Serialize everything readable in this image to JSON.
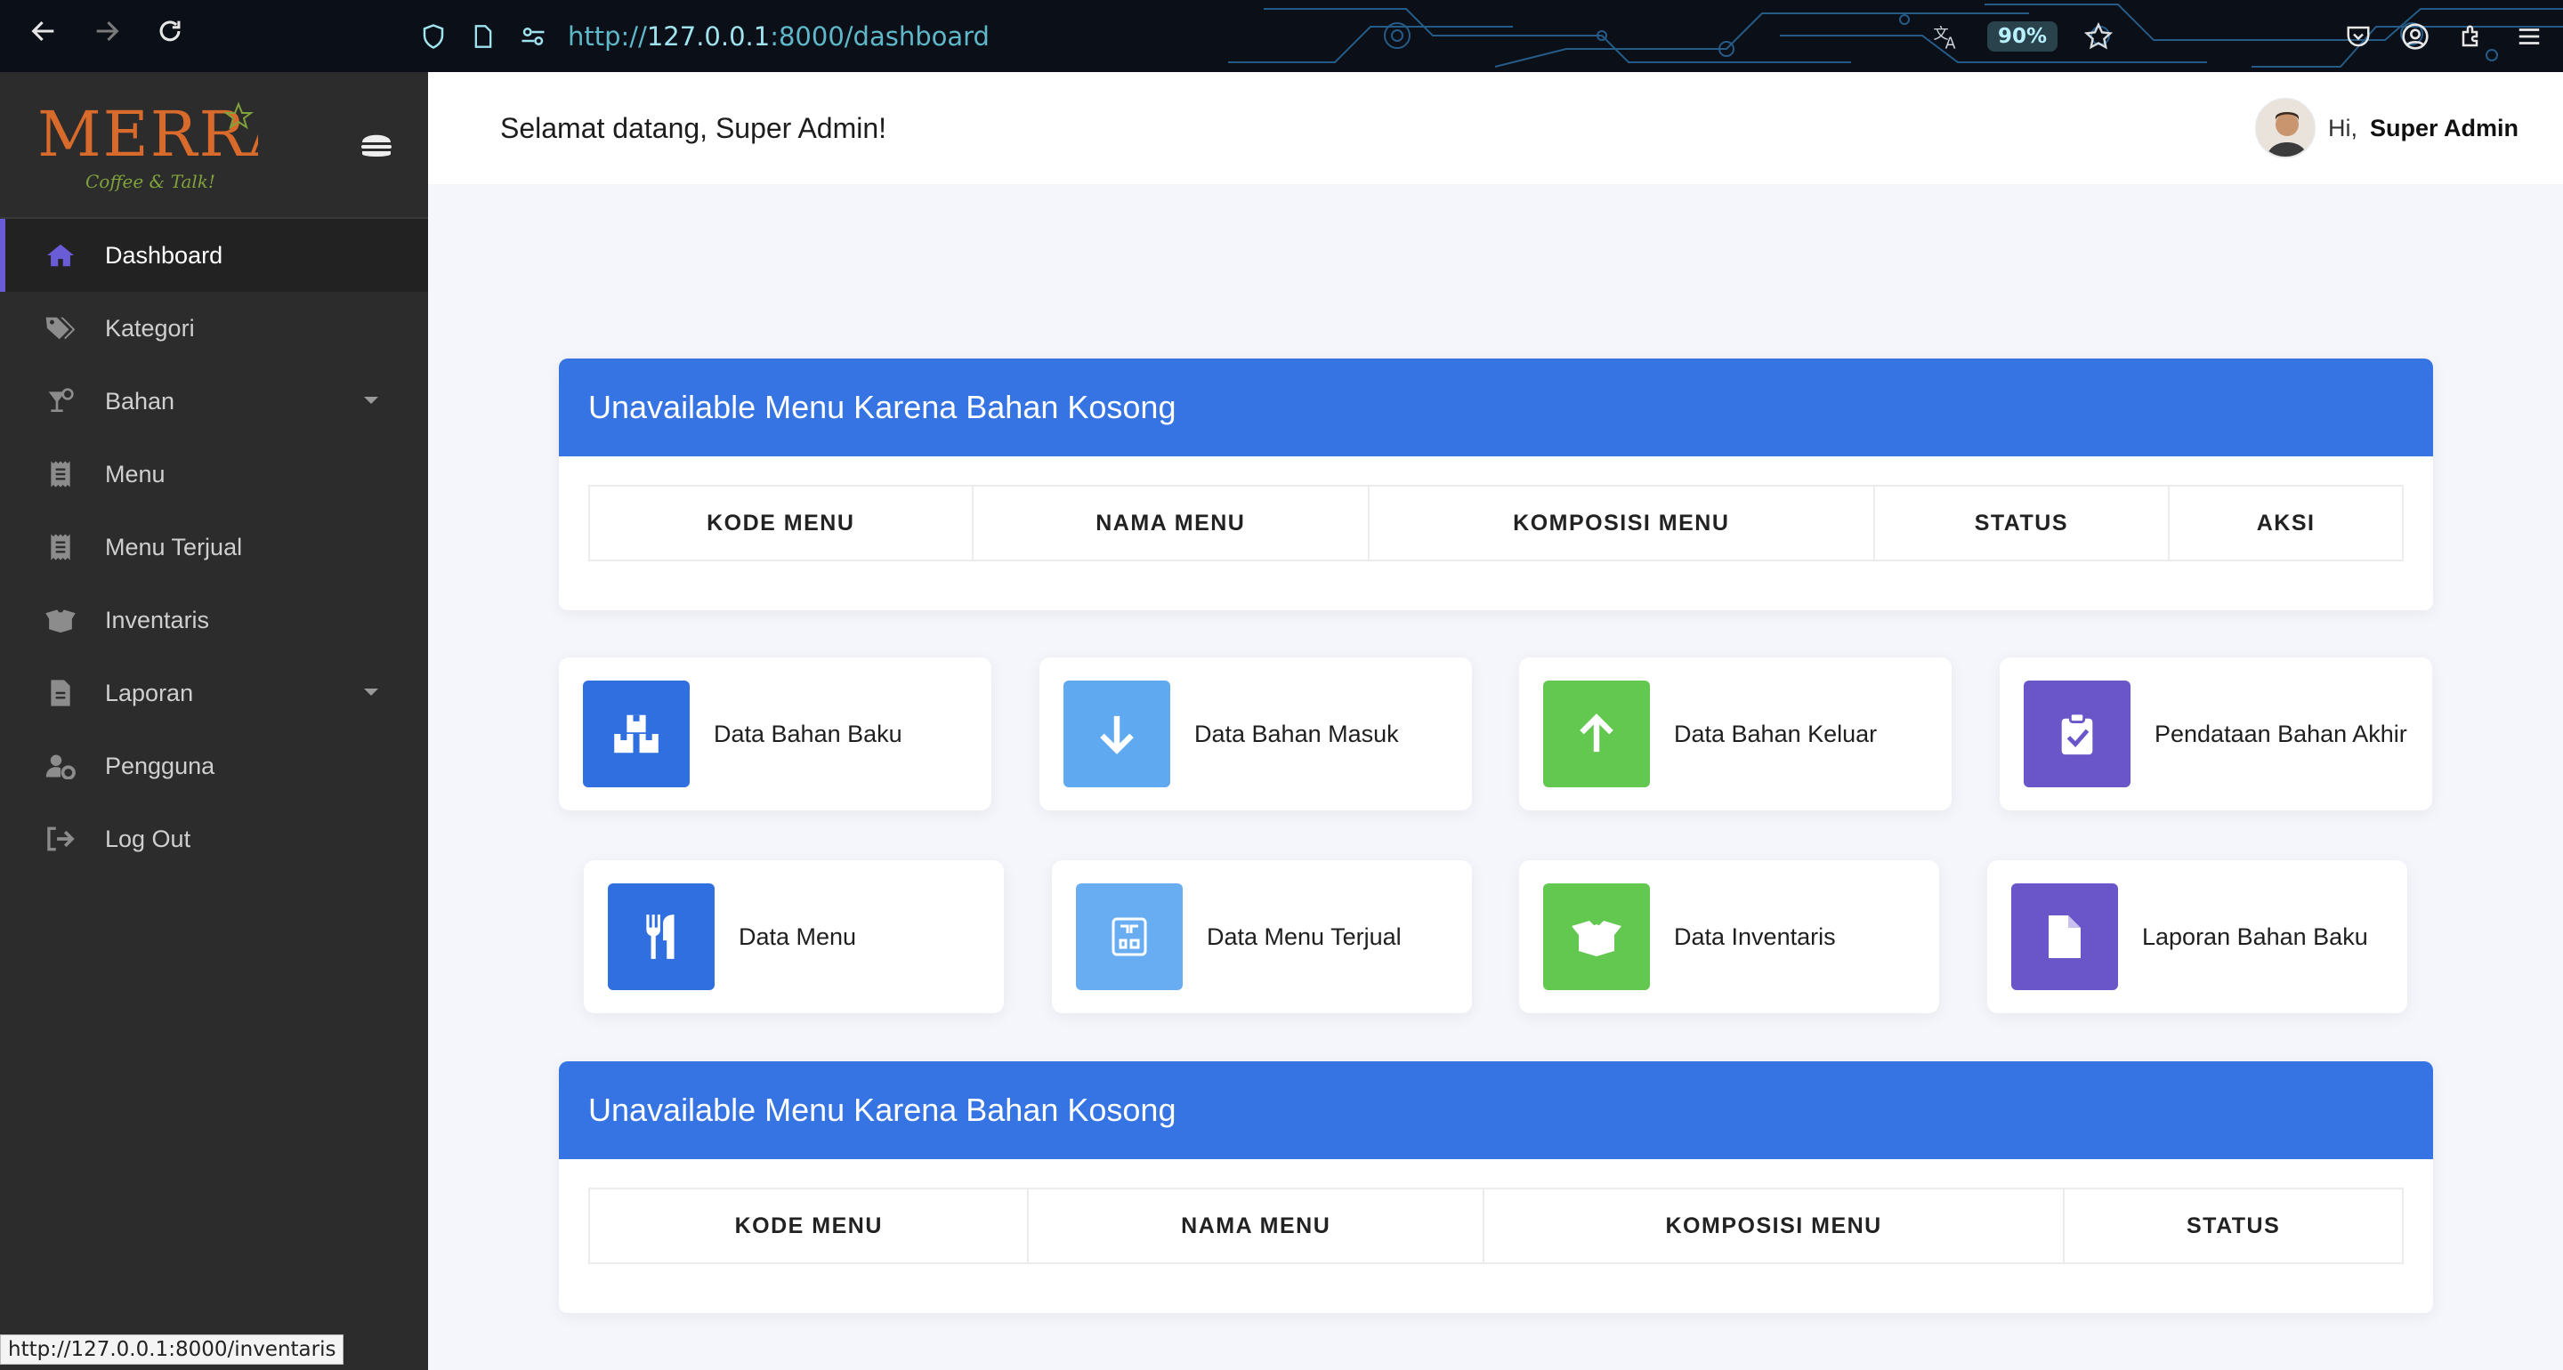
{
  "browser": {
    "url_scheme": "http://",
    "url_host": "127.0.0.1",
    "url_rest": ":8000/dashboard",
    "zoom": "90%",
    "status_link": "http://127.0.0.1:8000/inventaris"
  },
  "sidebar": {
    "logo_text": "MERRA",
    "logo_tagline": "Coffee & Talk!",
    "items": [
      {
        "label": "Dashboard",
        "icon": "home-icon",
        "active": true
      },
      {
        "label": "Kategori",
        "icon": "tags-icon"
      },
      {
        "label": "Bahan",
        "icon": "cocktail-icon",
        "dropdown": true
      },
      {
        "label": "Menu",
        "icon": "receipt-icon"
      },
      {
        "label": "Menu Terjual",
        "icon": "receipt-icon"
      },
      {
        "label": "Inventaris",
        "icon": "box-open-icon"
      },
      {
        "label": "Laporan",
        "icon": "file-icon",
        "dropdown": true
      },
      {
        "label": "Pengguna",
        "icon": "user-cog-icon"
      },
      {
        "label": "Log Out",
        "icon": "sign-out-icon"
      }
    ]
  },
  "header": {
    "welcome": "Selamat datang, Super Admin!",
    "greeting": "Hi,",
    "user_name": "Super Admin"
  },
  "tables": [
    {
      "title": "Unavailable Menu Karena Bahan Kosong",
      "columns": [
        "KODE MENU",
        "NAMA MENU",
        "KOMPOSISI MENU",
        "STATUS",
        "AKSI"
      ]
    },
    {
      "title": "Unavailable Menu Karena Bahan Kosong",
      "columns": [
        "KODE MENU",
        "NAMA MENU",
        "KOMPOSISI MENU",
        "STATUS"
      ]
    }
  ],
  "tiles": [
    {
      "label": "Data Bahan Baku",
      "icon": "boxes-icon",
      "color": "#2f6fe0"
    },
    {
      "label": "Data Bahan Masuk",
      "icon": "arrow-down-icon",
      "color": "#5ea9f0"
    },
    {
      "label": "Data Bahan Keluar",
      "icon": "arrow-up-icon",
      "color": "#62c84f"
    },
    {
      "label": "Pendataan Bahan Akhir",
      "icon": "clipboard-check-icon",
      "color": "#6a56c9"
    },
    {
      "label": "Data Menu",
      "icon": "utensils-icon",
      "color": "#2f6fe0"
    },
    {
      "label": "Data Menu Terjual",
      "icon": "qrcode-icon",
      "color": "#68adf2"
    },
    {
      "label": "Data Inventaris",
      "icon": "box-open-icon",
      "color": "#62c84f"
    },
    {
      "label": "Laporan Bahan Baku",
      "icon": "file-icon",
      "color": "#6a56c9"
    }
  ]
}
